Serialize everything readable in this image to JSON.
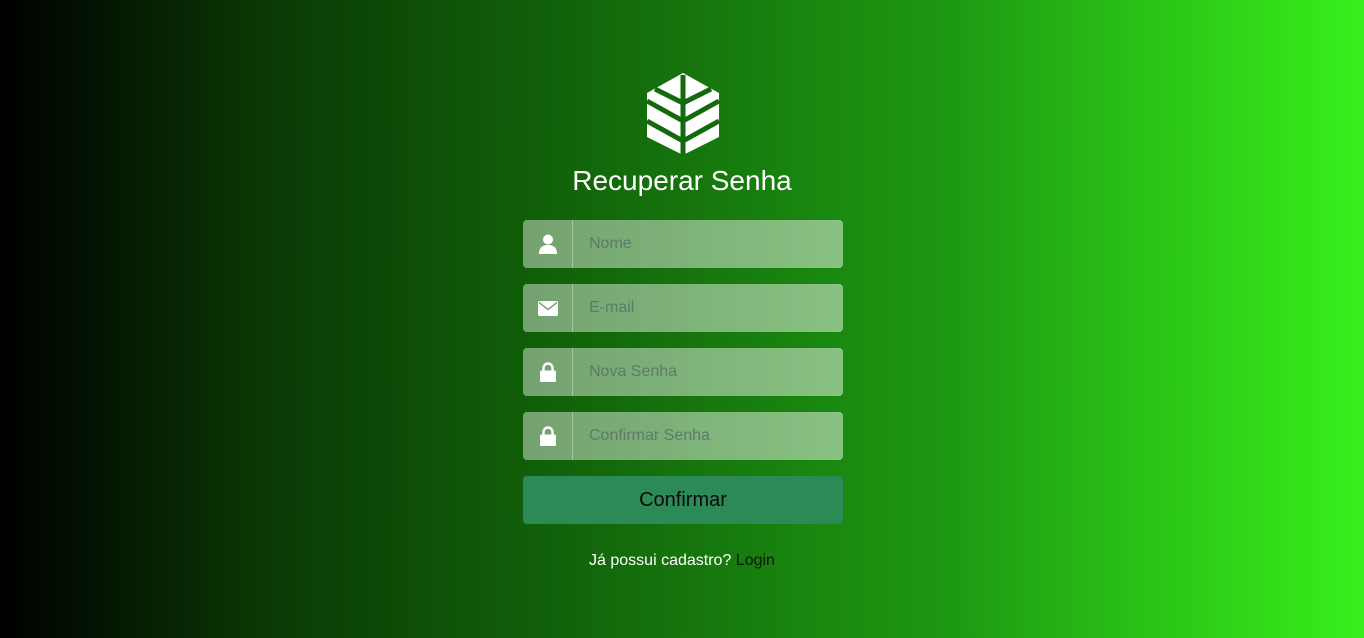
{
  "header": {
    "title": "Recuperar Senha",
    "logo_icon": "leaf-hexagon-icon"
  },
  "form": {
    "fields": [
      {
        "icon": "user-icon",
        "placeholder": "Nome",
        "value": ""
      },
      {
        "icon": "envelope-icon",
        "placeholder": "E-mail",
        "value": ""
      },
      {
        "icon": "lock-icon",
        "placeholder": "Nova Senha",
        "value": ""
      },
      {
        "icon": "lock-icon",
        "placeholder": "Confirmar Senha",
        "value": ""
      }
    ],
    "submit_label": "Confirmar"
  },
  "footer": {
    "prompt": "Já possui cadastro?",
    "login_label": "Login"
  },
  "colors": {
    "button": "#2c8a57",
    "gradient_start": "#000000",
    "gradient_end": "#38f01c"
  }
}
